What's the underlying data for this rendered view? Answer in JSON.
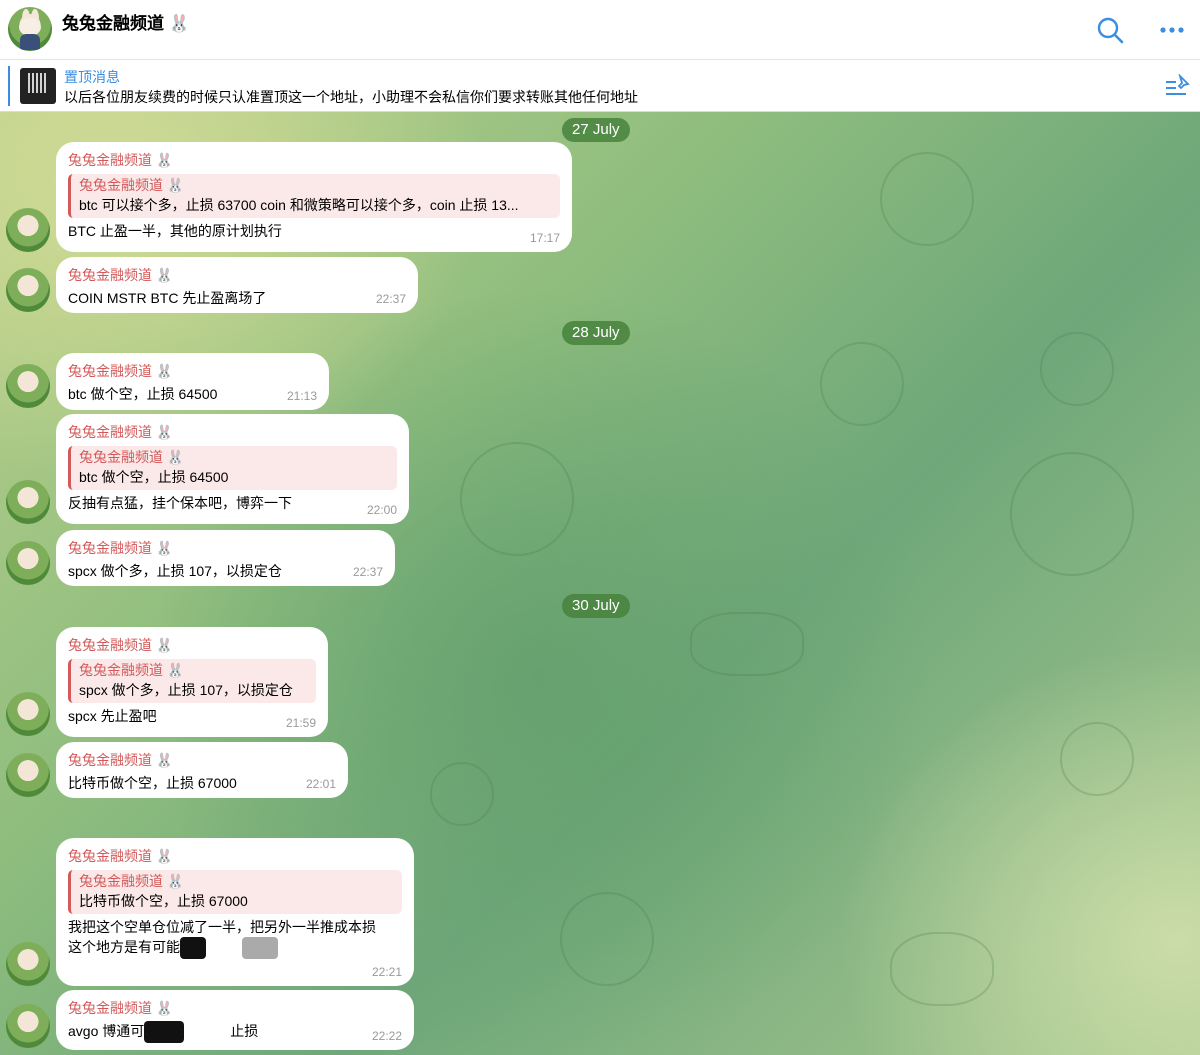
{
  "channel": {
    "title": "兔兔金融频道 🐰"
  },
  "pinned": {
    "label": "置顶消息",
    "text": "以后各位朋友续费的时候只认准置顶这一个地址，小助理不会私信你们要求转账其他任何地址"
  },
  "dates": [
    "27 July",
    "28 July",
    "30 July"
  ],
  "messages": [
    {
      "sender": "兔兔金融频道 🐰",
      "reply_sender": "兔兔金融频道 🐰",
      "reply_text": "btc 可以接个多，止损 63700 coin 和微策略可以接个多，coin 止损 13...",
      "text": "BTC 止盈一半，其他的原计划执行",
      "time": "17:17"
    },
    {
      "sender": "兔兔金融频道 🐰",
      "text": "COIN MSTR BTC 先止盈离场了",
      "time": "22:37"
    },
    {
      "sender": "兔兔金融频道 🐰",
      "text": "btc 做个空，止损 64500",
      "time": "21:13"
    },
    {
      "sender": "兔兔金融频道 🐰",
      "reply_sender": "兔兔金融频道 🐰",
      "reply_text": "btc 做个空，止损 64500",
      "text": "反抽有点猛，挂个保本吧，博弈一下",
      "time": "22:00"
    },
    {
      "sender": "兔兔金融频道 🐰",
      "text": "spcx 做个多，止损 107，以损定仓",
      "time": "22:37"
    },
    {
      "sender": "兔兔金融频道 🐰",
      "reply_sender": "兔兔金融频道 🐰",
      "reply_text": "spcx 做个多，止损 107，以损定仓",
      "text": "spcx 先止盈吧",
      "time": "21:59"
    },
    {
      "sender": "兔兔金融频道 🐰",
      "text": "比特币做个空，止损 67000",
      "time": "22:01"
    },
    {
      "sender": "兔兔金融频道 🐰",
      "reply_sender": "兔兔金融频道 🐰",
      "reply_text": "比特币做个空，止损 67000",
      "text": "我把这个空单仓位减了一半，把另外一半推成本损",
      "text2": "这个地方是有可能",
      "time": "22:21"
    },
    {
      "sender": "兔兔金融频道 🐰",
      "text": "avgo 博通可",
      "text_end": "止损",
      "time": "22:22"
    }
  ]
}
